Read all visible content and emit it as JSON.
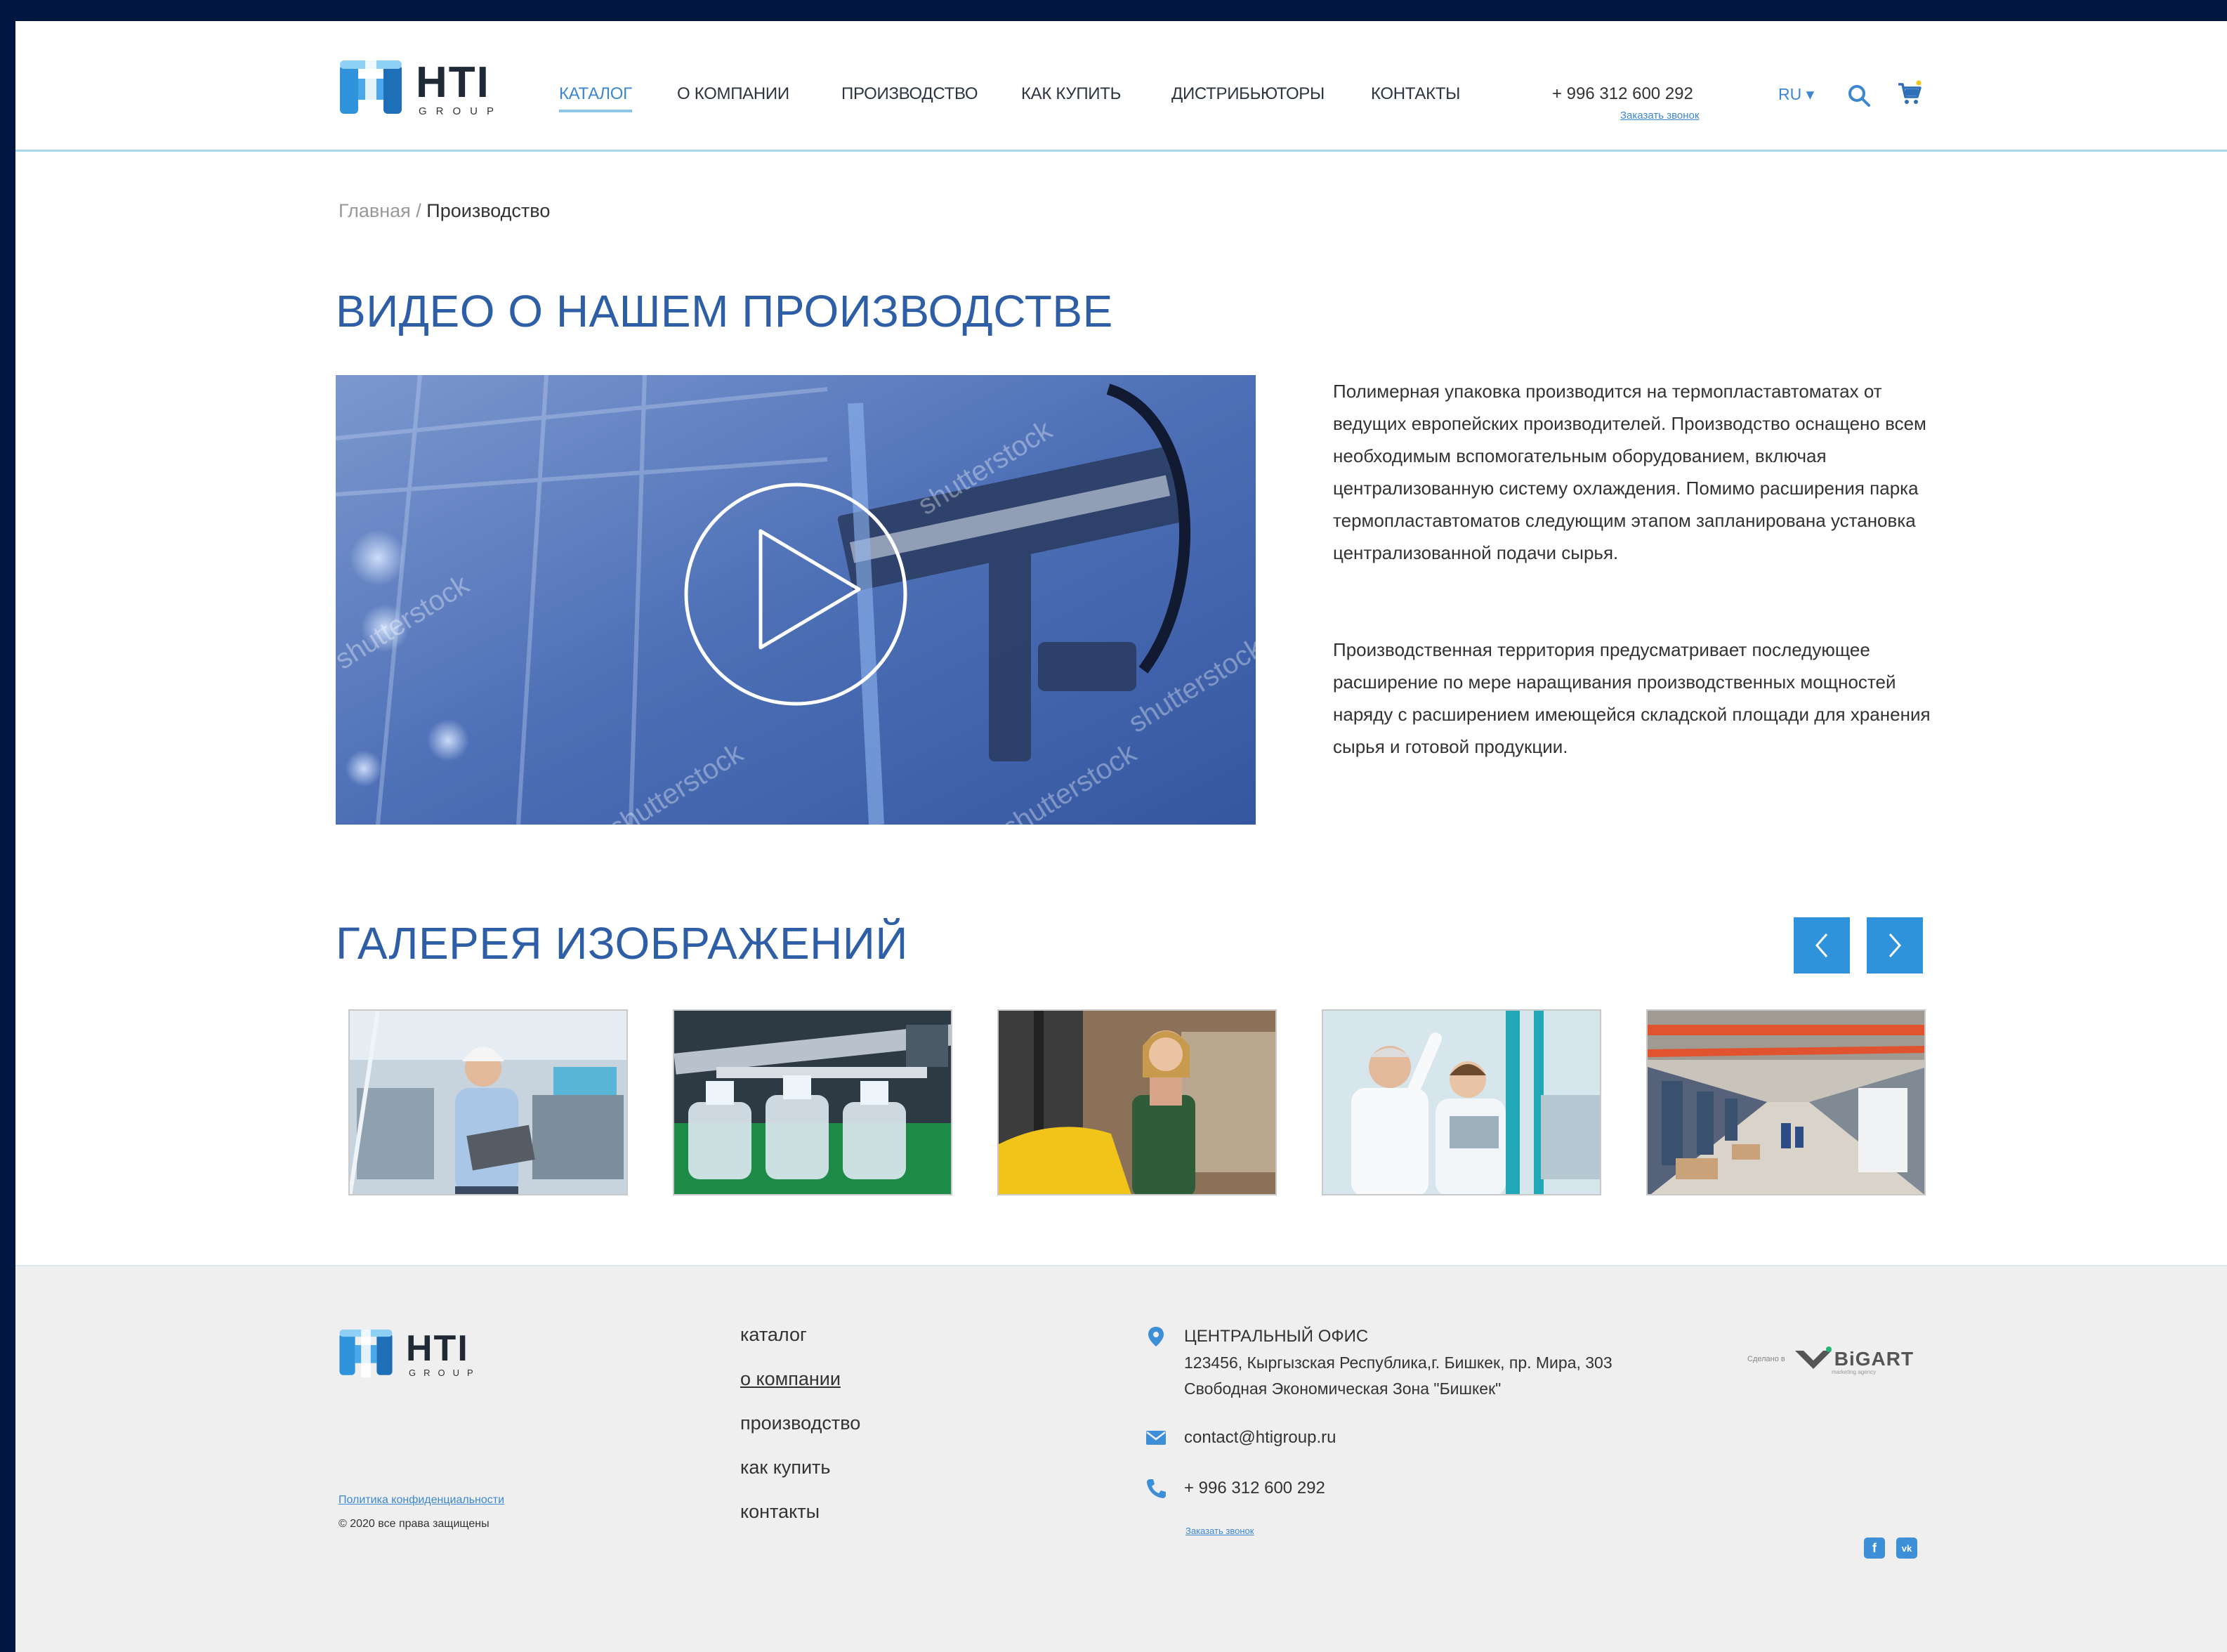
{
  "header": {
    "logo_big": "HTI",
    "logo_small": "GROUP",
    "nav": [
      {
        "label": "КАТАЛОГ"
      },
      {
        "label": "О КОМПАНИИ"
      },
      {
        "label": "ПРОИЗВОДСТВО"
      },
      {
        "label": "КАК КУПИТЬ"
      },
      {
        "label": "ДИСТРИБЬЮТОРЫ"
      },
      {
        "label": "КОНТАКТЫ"
      }
    ],
    "phone": "+ 996  312  600  292",
    "callback": "Заказать звонок",
    "lang": "RU ▾",
    "icons": [
      "search-icon",
      "cart-icon"
    ]
  },
  "breadcrumb": {
    "home": "Главная",
    "separator": " / ",
    "current": "Производство"
  },
  "video_section": {
    "title": "ВИДЕО О НАШЕМ ПРОИЗВОДСТВЕ",
    "paragraph1": "Полимерная упаковка производится на термопластавтоматах от ведущих европейских производителей. Производство оснащено всем необходимым вспомогательным оборудованием, включая централизованную систему охлаждения. Помимо расширения парка термопластавтоматов следующим этапом запланирована установка централизованной подачи сырья.",
    "paragraph2": "Производственная территория предусматривает последующее расширение по мере наращивания производственных мощностей наряду с расширением имеющейся складской площади для хранения сырья и готовой продукции.",
    "watermark": "shutterstock"
  },
  "gallery": {
    "title": "ГАЛЕРЕЯ ИЗОБРАЖЕНИЙ",
    "prev_icon": "chevron-left-icon",
    "next_icon": "chevron-right-icon"
  },
  "footer": {
    "logo_big": "HTI",
    "logo_small": "GROUP",
    "links": [
      {
        "label": "каталог"
      },
      {
        "label": "о компании"
      },
      {
        "label": "производство"
      },
      {
        "label": "как купить"
      },
      {
        "label": "контакты"
      }
    ],
    "privacy": "Политика конфиденциальности",
    "copyright": "© 2020 все права защищены",
    "office_title": "ЦЕНТРАЛЬНЫЙ ОФИС",
    "address_line1": "123456, Кыргызская Республика,г. Бишкек, пр. Мира, 303",
    "address_line2": "Свободная Экономическая Зона \"Бишкек\"",
    "email": "contact@htigroup.ru",
    "phone": "+ 996  312  600  292",
    "callback": "Заказать звонок",
    "madeby_label": "Сделано в",
    "madeby_brand": "BiGART",
    "madeby_sub": "marketing agency",
    "social": [
      {
        "label": "f"
      },
      {
        "label": "vk"
      }
    ]
  },
  "colors": {
    "accent": "#3d87d1",
    "title_blue": "#2d5ea6",
    "button_blue": "#2f93dc",
    "frame": "#02173f"
  }
}
